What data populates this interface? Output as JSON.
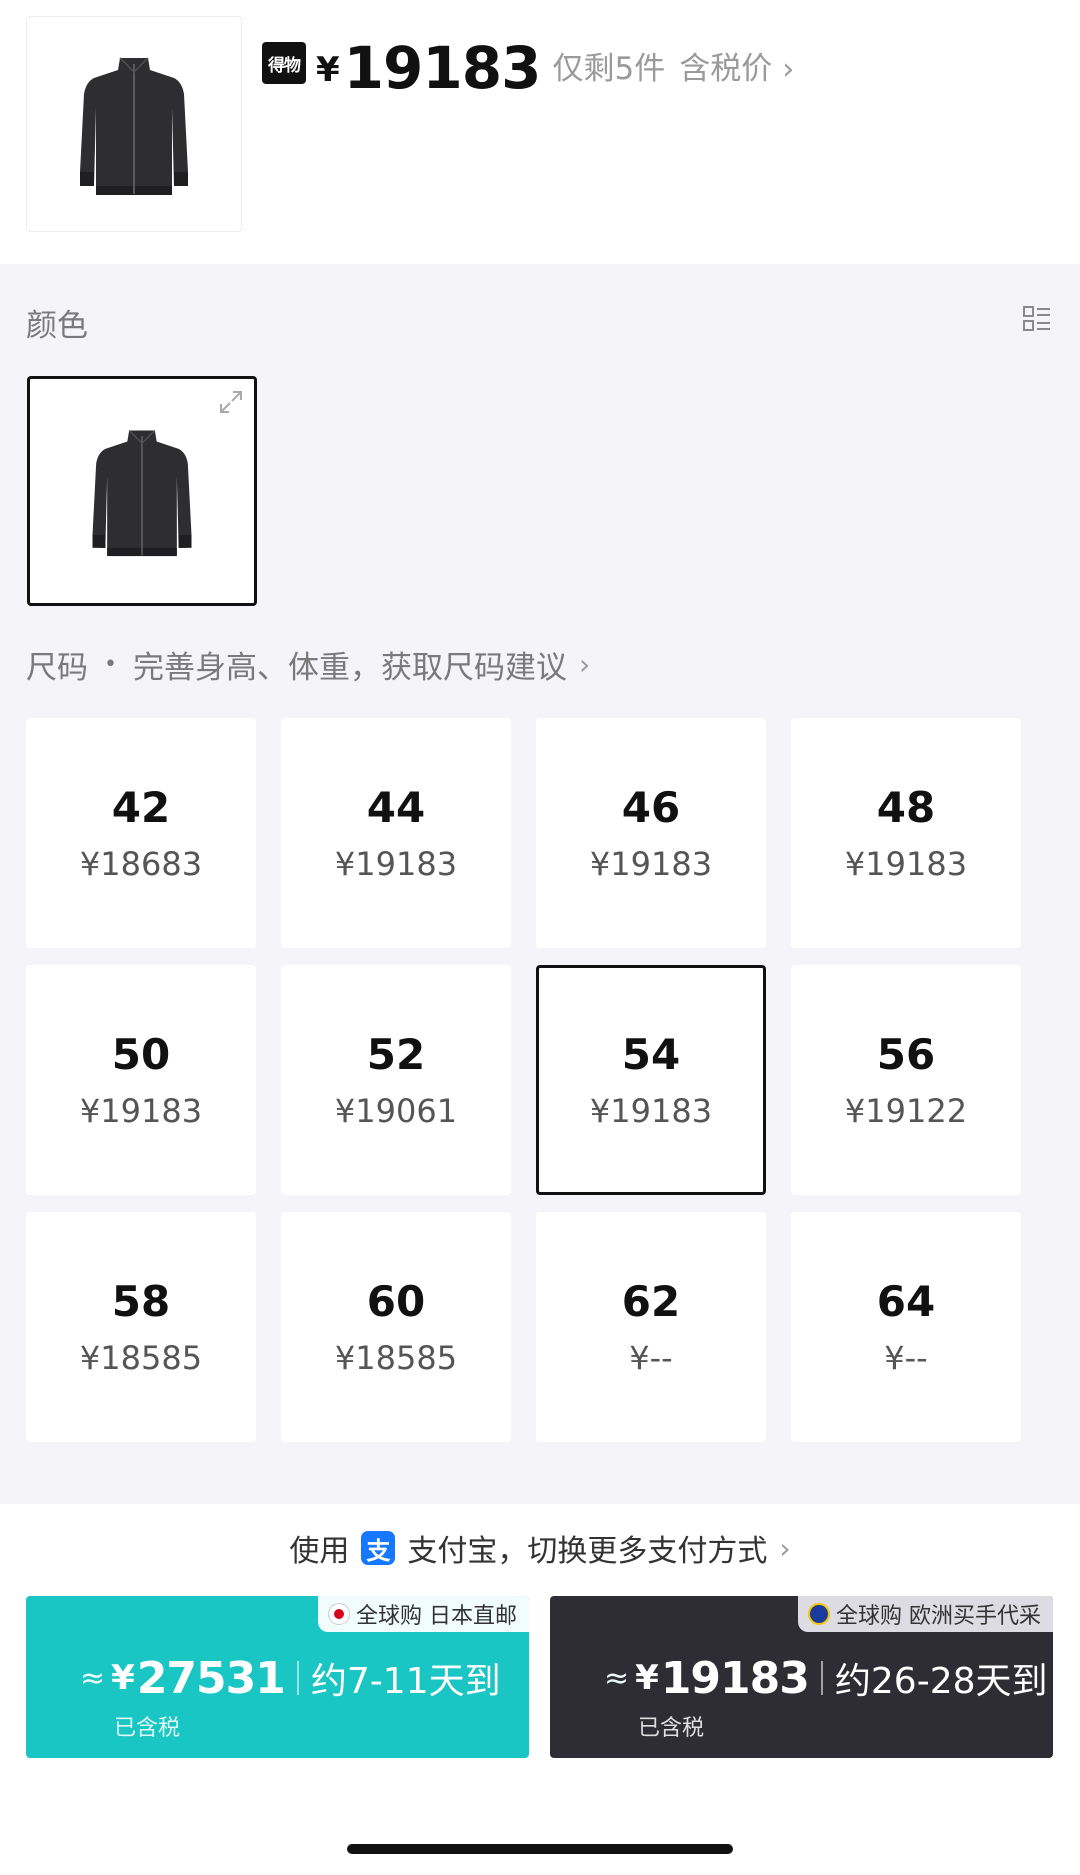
{
  "header": {
    "brand_logo_text": "得物",
    "currency": "¥",
    "price": "19183",
    "stock_text": "仅剩5件",
    "tax_text": "含税价"
  },
  "color_section": {
    "label": "颜色"
  },
  "size_section": {
    "label": "尺码",
    "hint": "完善身高、体重，获取尺码建议",
    "selected_size": "54",
    "sizes": [
      {
        "size": "42",
        "price": "¥18683"
      },
      {
        "size": "44",
        "price": "¥19183"
      },
      {
        "size": "46",
        "price": "¥19183"
      },
      {
        "size": "48",
        "price": "¥19183"
      },
      {
        "size": "50",
        "price": "¥19183"
      },
      {
        "size": "52",
        "price": "¥19061"
      },
      {
        "size": "54",
        "price": "¥19183"
      },
      {
        "size": "56",
        "price": "¥19122"
      },
      {
        "size": "58",
        "price": "¥18585"
      },
      {
        "size": "60",
        "price": "¥18585"
      },
      {
        "size": "62",
        "price": "¥--"
      },
      {
        "size": "64",
        "price": "¥--"
      }
    ]
  },
  "payment": {
    "prefix": "使用",
    "method": "支付宝，切换更多支付方式",
    "icon": "alipay-icon"
  },
  "buy_options": [
    {
      "tag": "全球购 日本直邮",
      "approx": "≈",
      "currency": "¥",
      "price": "27531",
      "eta": "约7-11天到",
      "tax_note": "已含税",
      "color": "#19c6c3"
    },
    {
      "tag": "全球购 欧洲买手代采",
      "approx": "≈",
      "currency": "¥",
      "price": "19183",
      "eta": "约26-28天到",
      "tax_note": "已含税",
      "color": "#2d2d33"
    }
  ]
}
